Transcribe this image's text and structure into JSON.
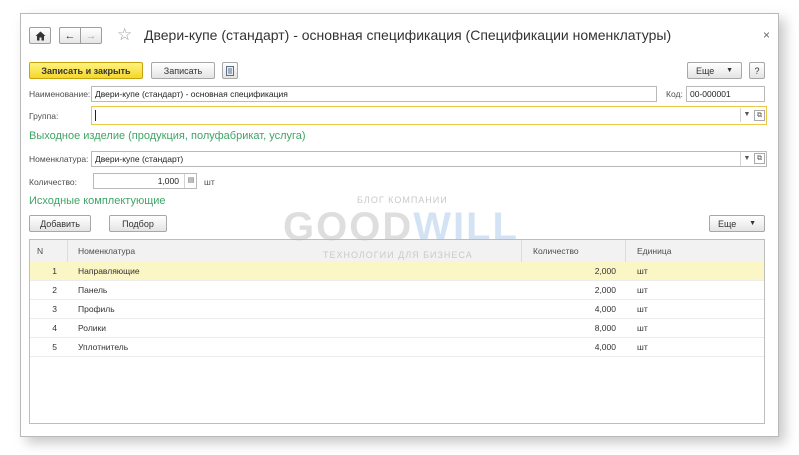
{
  "window": {
    "title": "Двери-купе (стандарт) - основная спецификация (Спецификации номенклатуры)"
  },
  "toolbar": {
    "save_close_label": "Записать и закрыть",
    "save_label": "Записать",
    "more_label": "Еще",
    "help_label": "?"
  },
  "form": {
    "name_label": "Наименование:",
    "name_value": "Двери-купе (стандарт) - основная спецификация",
    "code_label": "Код:",
    "code_value": "00-000001",
    "group_label": "Группа:",
    "group_value": "",
    "output_section": "Выходное изделие (продукция, полуфабрикат, услуга)",
    "nomenclature_label": "Номенклатура:",
    "nomenclature_value": "Двери-купе (стандарт)",
    "quantity_label": "Количество:",
    "quantity_value": "1,000",
    "unit_value": "шт",
    "components_section": "Исходные комплектующие"
  },
  "components_toolbar": {
    "add_label": "Добавить",
    "select_label": "Подбор",
    "more_label": "Еще"
  },
  "table": {
    "columns": [
      "N",
      "Номенклатура",
      "Количество",
      "Единица"
    ],
    "rows": [
      {
        "n": "1",
        "name": "Направляющие",
        "qty": "2,000",
        "unit": "шт"
      },
      {
        "n": "2",
        "name": "Панель",
        "qty": "2,000",
        "unit": "шт"
      },
      {
        "n": "3",
        "name": "Профиль",
        "qty": "4,000",
        "unit": "шт"
      },
      {
        "n": "4",
        "name": "Ролики",
        "qty": "8,000",
        "unit": "шт"
      },
      {
        "n": "5",
        "name": "Уплотнитель",
        "qty": "4,000",
        "unit": "шт"
      }
    ]
  },
  "watermark": {
    "top": "БЛОГ КОМПАНИИ",
    "logo_a": "GOOD",
    "logo_b": "WILL",
    "bottom": "ТЕХНОЛОГИИ ДЛЯ БИЗНЕСА"
  },
  "colors": {
    "accent_green": "#3fa566",
    "primary_button": "#f4d82a",
    "selected_row": "#fbf6c6"
  }
}
